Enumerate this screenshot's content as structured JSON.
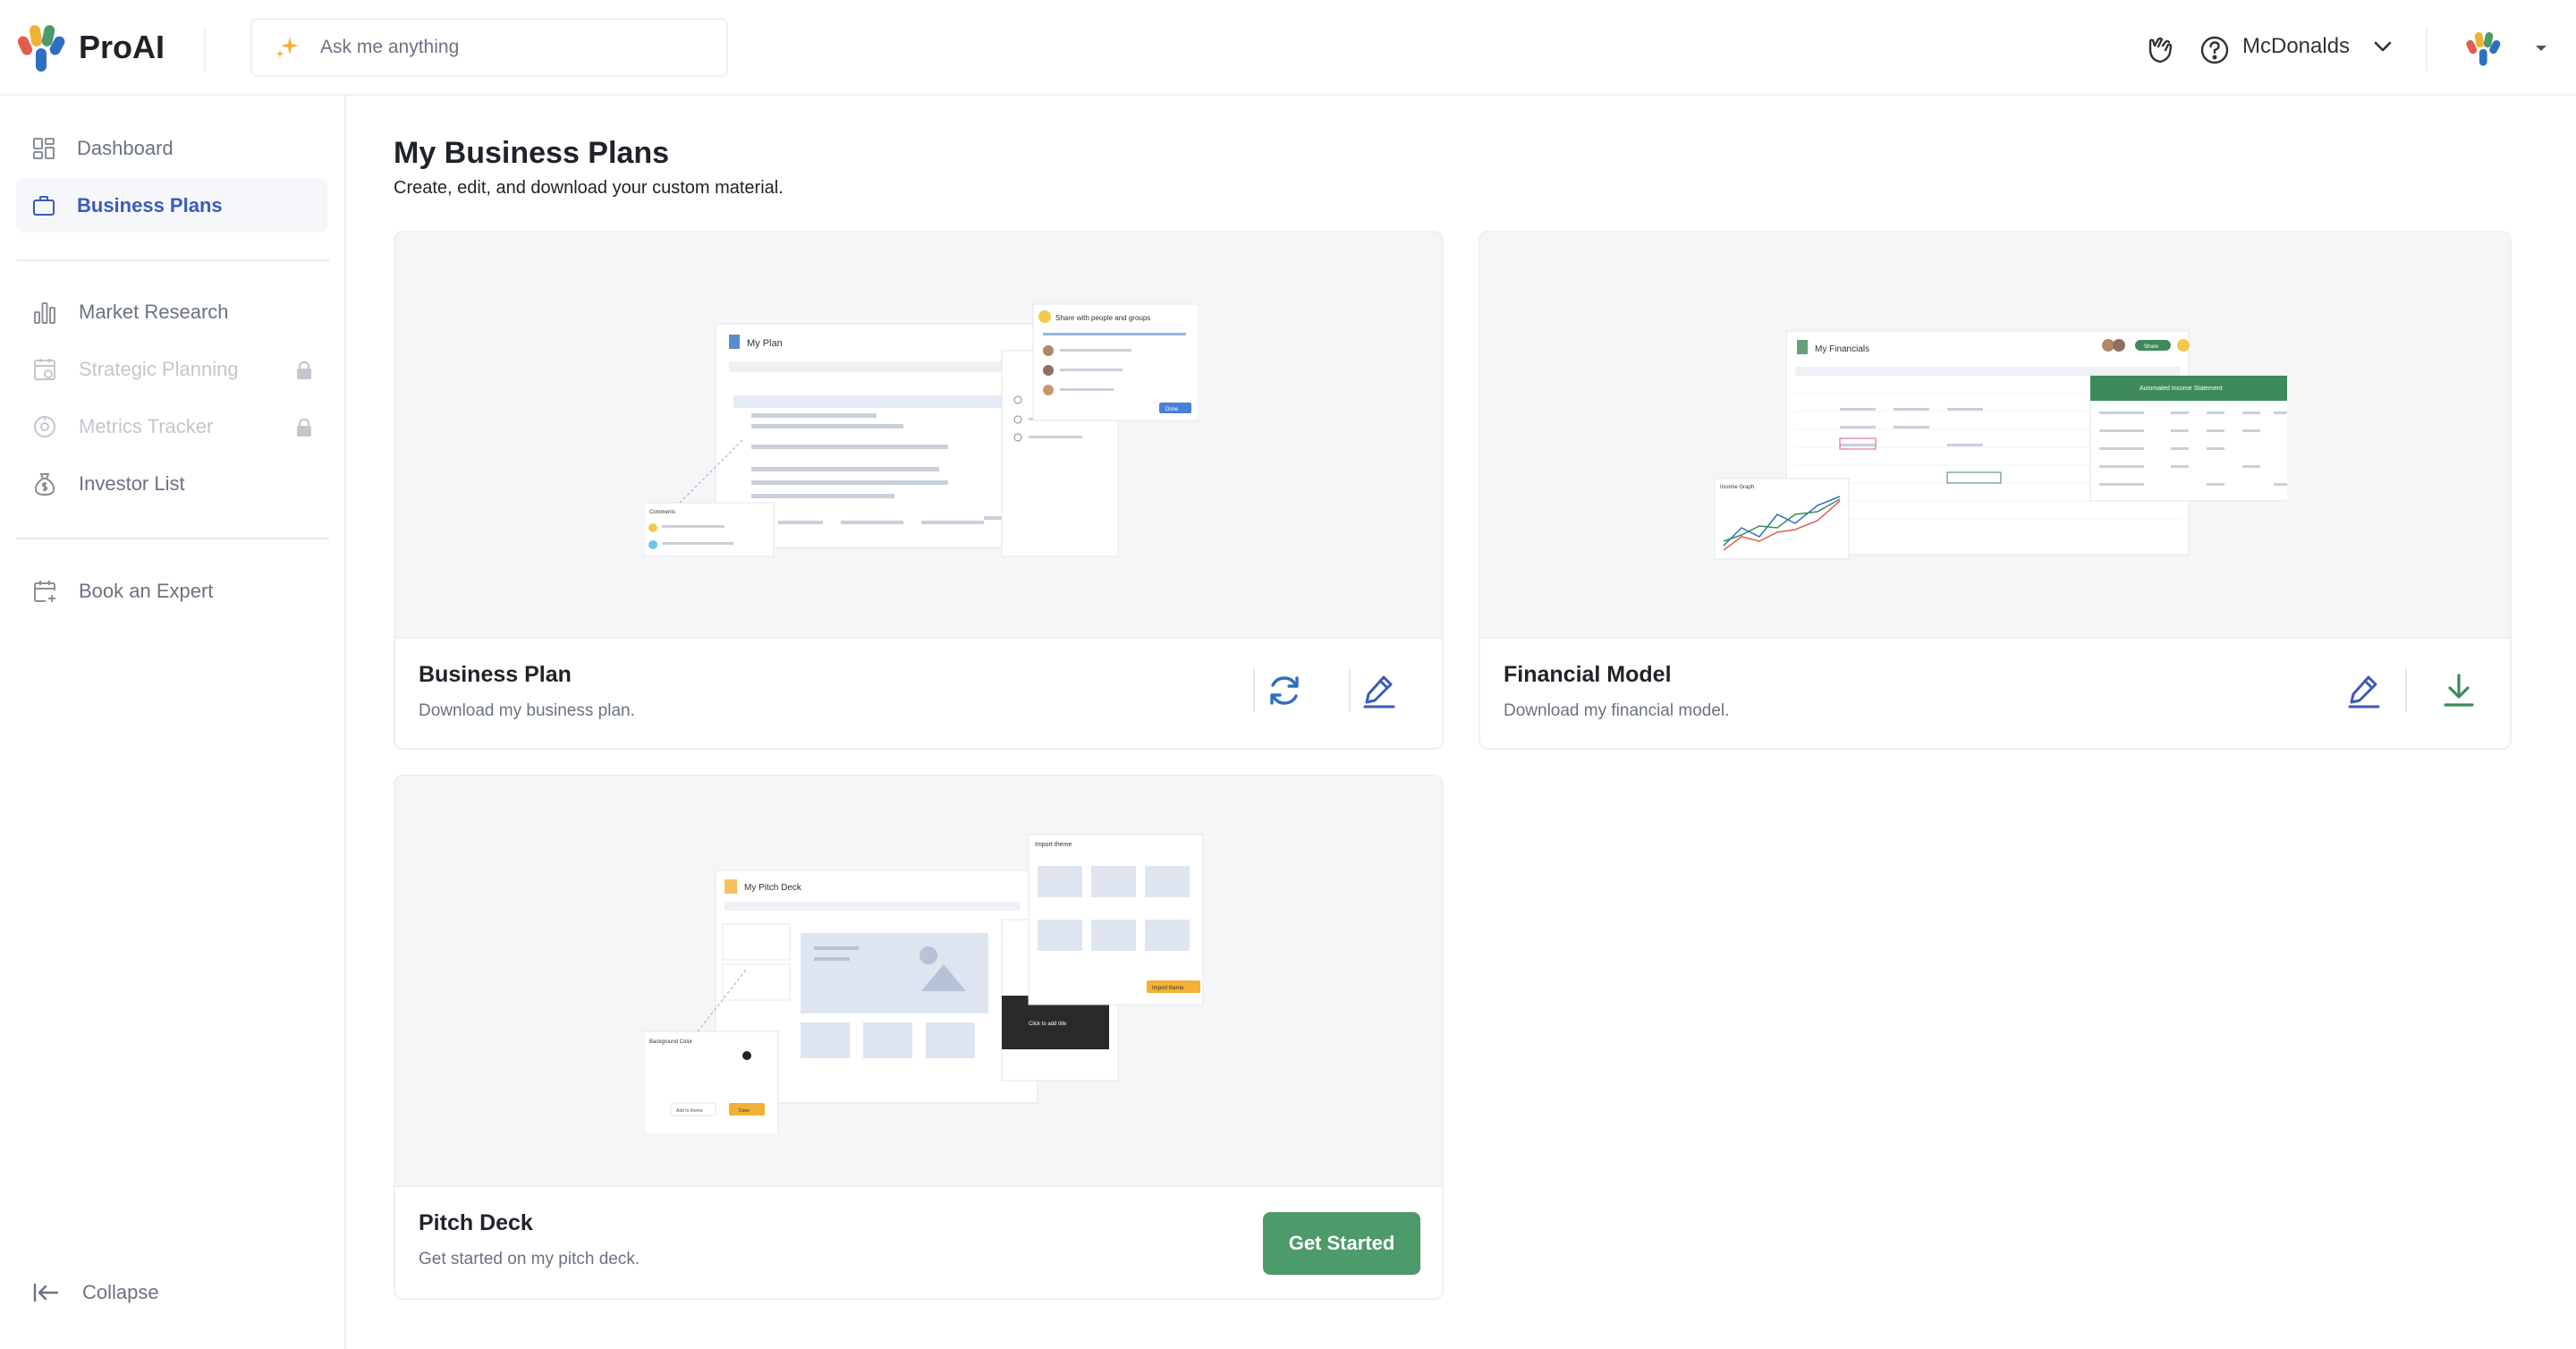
{
  "app": {
    "name": "ProAI"
  },
  "search": {
    "placeholder": "Ask me anything"
  },
  "header": {
    "company": "McDonalds"
  },
  "sidebar": {
    "items": [
      {
        "label": "Dashboard"
      },
      {
        "label": "Business Plans"
      },
      {
        "label": "Market Research"
      },
      {
        "label": "Strategic Planning"
      },
      {
        "label": "Metrics Tracker"
      },
      {
        "label": "Investor List"
      },
      {
        "label": "Book an Expert"
      }
    ],
    "collapse_label": "Collapse"
  },
  "main": {
    "title": "My Business Plans",
    "subtitle": "Create, edit, and download your custom material.",
    "cards": [
      {
        "title": "Business Plan",
        "desc": "Download my business plan."
      },
      {
        "title": "Financial Model",
        "desc": "Download my financial model."
      },
      {
        "title": "Pitch Deck",
        "desc": "Get started on my pitch deck.",
        "button": "Get Started"
      }
    ]
  },
  "previews": {
    "plan": {
      "doc_title": "My Plan",
      "share_title": "Share with people and groups",
      "share_button": "Done",
      "comments_title": "Comments"
    },
    "financial": {
      "doc_title": "My Financials",
      "statement_title": "Automated Income Statement",
      "share_button": "Share",
      "graph_title": "Income Graph"
    },
    "deck": {
      "doc_title": "My Pitch Deck",
      "theme_title": "Import theme",
      "theme_button": "Import theme",
      "bg_title": "Background Color",
      "slide_text": "Click to add title",
      "add_theme": "Add to theme",
      "done": "Done"
    }
  },
  "colors": {
    "accent": "#3b5bb6",
    "green": "#4d9a6a",
    "refresh": "#2e6fc2",
    "edit": "#3b5bb6",
    "download": "#3e8a5b"
  }
}
